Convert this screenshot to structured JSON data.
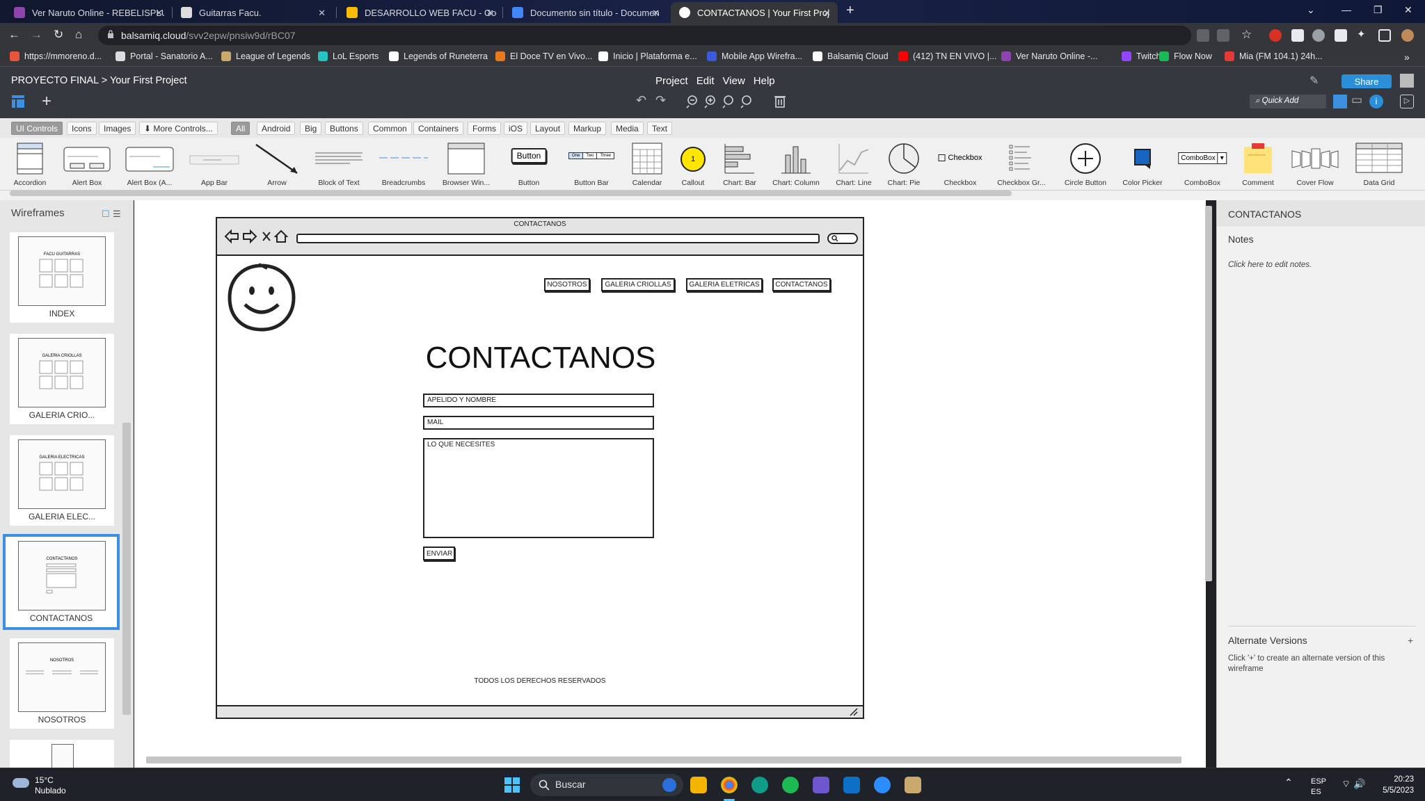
{
  "browser": {
    "tabs": [
      {
        "label": "Ver Naruto Online - REBELISPLUS",
        "color": "#8e44ad"
      },
      {
        "label": "Guitarras Facu.",
        "color": "#dddddd"
      },
      {
        "label": "DESARROLLO WEB FACU - Goog",
        "color": "#fbbc04"
      },
      {
        "label": "Documento sin título - Documen",
        "color": "#4285f4"
      },
      {
        "label": "CONTACTANOS | Your First Proje",
        "color": "#ffffff"
      }
    ],
    "url_host": "balsamiq.cloud",
    "url_path": "/svv2epw/pnsiw9d/rBC07",
    "bookmarks": [
      {
        "label": "https://mmoreno.d...",
        "color": "#e8553d"
      },
      {
        "label": "Portal - Sanatorio A...",
        "color": "#dddddd"
      },
      {
        "label": "League of Legends",
        "color": "#c8aa6e"
      },
      {
        "label": "LoL Esports",
        "color": "#27c4c4"
      },
      {
        "label": "Legends of Runeterra",
        "color": "#ffffff"
      },
      {
        "label": "El Doce TV en Vivo...",
        "color": "#e87a1e"
      },
      {
        "label": "Inicio | Plataforma e...",
        "color": "#ffffff"
      },
      {
        "label": "Mobile App Wirefra...",
        "color": "#3b5bdb"
      },
      {
        "label": "Balsamiq Cloud",
        "color": "#ffffff"
      },
      {
        "label": "(412) TN EN VIVO |...",
        "color": "#ff0000"
      },
      {
        "label": "Ver Naruto Online -...",
        "color": "#8e44ad"
      },
      {
        "label": "Twitch",
        "color": "#9146ff"
      },
      {
        "label": "Flow Now",
        "color": "#1db954"
      },
      {
        "label": "Mia (FM 104.1) 24h...",
        "color": "#e53935"
      }
    ],
    "bookmarks_more": "»"
  },
  "app": {
    "breadcrumb": "PROYECTO FINAL > Your First Project",
    "menus": [
      "Project",
      "Edit",
      "View",
      "Help"
    ],
    "share_label": "Share",
    "quick_add_placeholder": "Quick Add"
  },
  "filters": {
    "left": [
      "UI Controls",
      "Icons",
      "Images",
      "More Controls..."
    ],
    "categories": [
      "All",
      "Android",
      "Big",
      "Buttons",
      "Common",
      "Containers",
      "Forms",
      "iOS",
      "Layout",
      "Markup",
      "Media",
      "Text"
    ]
  },
  "controls": [
    "Accordion",
    "Alert Box",
    "Alert Box (A...",
    "App Bar",
    "Arrow",
    "Block of Text",
    "Breadcrumbs",
    "Browser Win...",
    "Button",
    "Button Bar",
    "Calendar",
    "Callout",
    "Chart: Bar",
    "Chart: Column",
    "Chart: Line",
    "Chart: Pie",
    "Checkbox",
    "Checkbox Gr...",
    "Circle Button",
    "Color Picker",
    "ComboBox",
    "Comment",
    "Cover Flow",
    "Data Grid"
  ],
  "control_thumbs": {
    "button": "Button",
    "checkbox": "Checkbox",
    "combobox": "ComboBox",
    "callout": "1",
    "button_bar": [
      "One",
      "Two",
      "Three"
    ]
  },
  "wireframes": {
    "title": "Wireframes",
    "items": [
      {
        "name": "INDEX",
        "thumb_title": "FACU GUITARRAS"
      },
      {
        "name": "GALERIA CRIO...",
        "thumb_title": "GALERIA CRIOLLAS"
      },
      {
        "name": "GALERIA ELEC...",
        "thumb_title": "GALERIA ELECTRICAS"
      },
      {
        "name": "CONTACTANOS",
        "thumb_title": "CONTACTANOS"
      },
      {
        "name": "NOSOTROS",
        "thumb_title": "NOSOTROS"
      }
    ],
    "selected": "CONTACTANOS"
  },
  "wireframe": {
    "browser_title": "CONTACTANOS",
    "nav": [
      "NOSOTROS",
      "GALERIA CRIOLLAS",
      "GALERIA ELETRICAS",
      "CONTACTANOS"
    ],
    "heading": "CONTACTANOS",
    "field_name": "APELIDO Y NOMBRE",
    "field_mail": "MAIL",
    "field_message": "LO QUE NECESITES",
    "submit": "ENVIAR",
    "footer": "TODOS LOS DERECHOS RESERVADOS"
  },
  "inspector": {
    "title": "CONTACTANOS",
    "notes_label": "Notes",
    "notes_hint": "Click here to edit notes.",
    "alt_label": "Alternate Versions",
    "alt_plus": "+",
    "alt_hint": "Click '+' to create an alternate version of this wireframe"
  },
  "taskbar": {
    "temp": "15°C",
    "weather": "Nublado",
    "search": "Buscar",
    "lang1": "ESP",
    "lang2": "ES",
    "time": "20:23",
    "date": "5/5/2023"
  }
}
